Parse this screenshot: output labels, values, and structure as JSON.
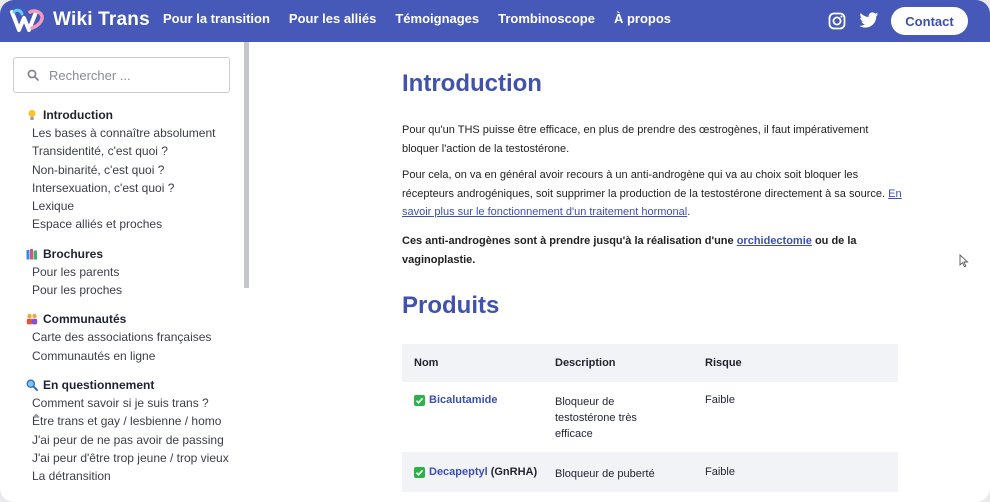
{
  "header": {
    "brand": "Wiki Trans",
    "nav": [
      "Pour la transition",
      "Pour les alliés",
      "Témoignages",
      "Trombinoscope",
      "À propos"
    ],
    "contact_label": "Contact",
    "colors": {
      "bar": "#4759b8",
      "accent": "#4152ad"
    }
  },
  "sidebar": {
    "search_placeholder": "Rechercher ...",
    "sections": [
      {
        "title": "Introduction",
        "icon": "lightbulb-icon",
        "items": [
          "Les bases à connaître absolument",
          "Transidentité, c'est quoi ?",
          "Non-binarité, c'est quoi ?",
          "Intersexuation, c'est quoi ?",
          "Lexique",
          "Espace alliés et proches"
        ]
      },
      {
        "title": "Brochures",
        "icon": "books-icon",
        "items": [
          "Pour les parents",
          "Pour les proches"
        ]
      },
      {
        "title": "Communautés",
        "icon": "people-icon",
        "items": [
          "Carte des associations françaises",
          "Communautés en ligne"
        ]
      },
      {
        "title": "En questionnement",
        "icon": "magnifier-icon",
        "items": [
          "Comment savoir si je suis trans ?",
          "Être trans et gay / lesbienne / homo",
          "J'ai peur de ne pas avoir de passing",
          "J'ai peur d'être trop jeune / trop vieux",
          "La détransition"
        ]
      }
    ]
  },
  "main": {
    "title": "Introduction",
    "p1": "Pour qu'un THS puisse être efficace, en plus de prendre des œstrogènes, il faut impérativement bloquer l'action de la testostérone.",
    "p2_text": "Pour cela, on va en général avoir recours à un anti-androgène qui va au choix soit bloquer les récepteurs androgéniques, soit supprimer la production de la testostérone directement à sa source. ",
    "p2_link": "En savoir plus sur le fonctionnement d'un traitement hormonal",
    "p2_end": ".",
    "p3_text": "Ces anti-androgènes sont à prendre jusqu'à la réalisation d'une ",
    "p3_link": "orchidectomie",
    "p3_mid": " ou de la vaginoplastie",
    "p3_end": ".",
    "products_title": "Produits",
    "table": {
      "headers": [
        "Nom",
        "Description",
        "Risque"
      ],
      "rows": [
        {
          "name": "Bicalutamide",
          "extra": "",
          "description": "Bloqueur de testostérone très efficace",
          "risk": "Faible"
        },
        {
          "name": "Decapeptyl",
          "extra": "(GnRHA)",
          "description": "Bloqueur de puberté",
          "risk": "Faible"
        }
      ]
    }
  }
}
